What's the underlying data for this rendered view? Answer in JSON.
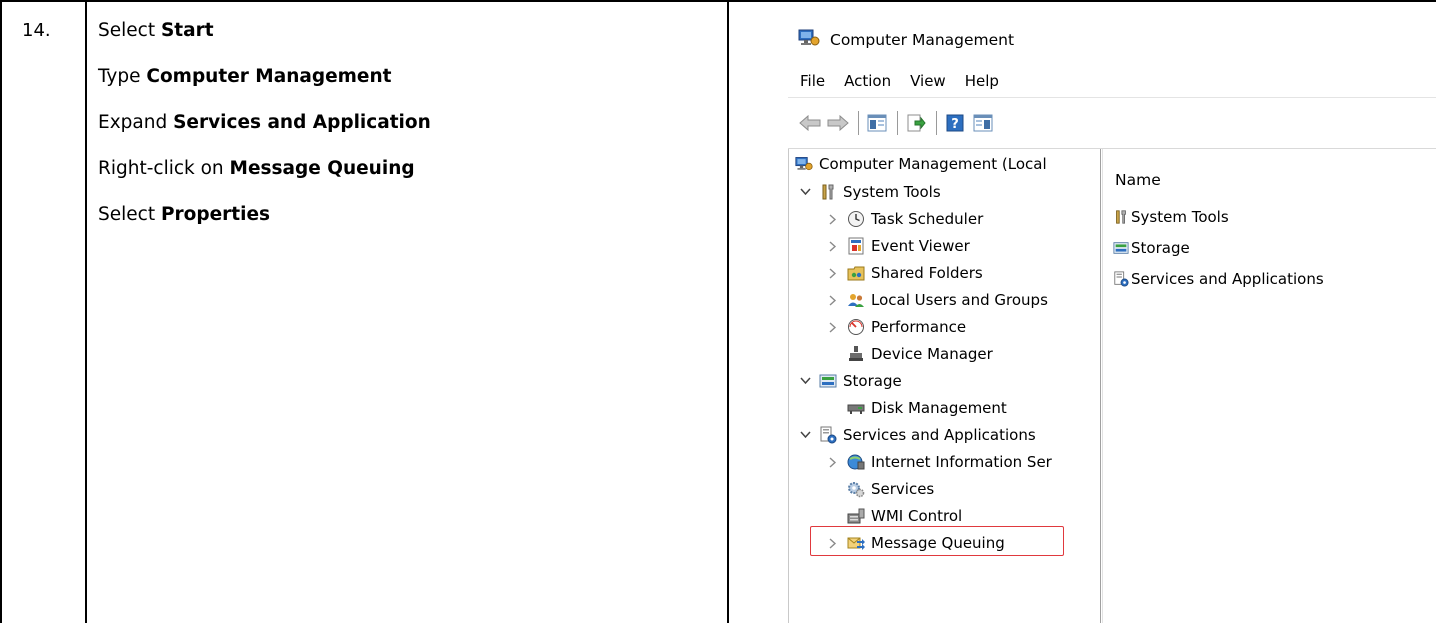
{
  "step": {
    "number": "14.",
    "lines": [
      {
        "prefix": "Select ",
        "bold": "Start"
      },
      {
        "prefix": "Type ",
        "bold": "Computer Management"
      },
      {
        "prefix": "Expand ",
        "bold": "Services and Application"
      },
      {
        "prefix": "Right-click on ",
        "bold": "Message Queuing"
      },
      {
        "prefix": "Select ",
        "bold": "Properties"
      }
    ]
  },
  "window": {
    "title": "Computer Management",
    "menu": [
      "File",
      "Action",
      "View",
      "Help"
    ]
  },
  "tree": {
    "root": "Computer Management (Local",
    "nodes": [
      {
        "label": "System Tools",
        "icon": "tools-icon",
        "expand": "expanded",
        "level": 1
      },
      {
        "label": "Task Scheduler",
        "icon": "clock-icon",
        "expand": "collapsed",
        "level": 2
      },
      {
        "label": "Event Viewer",
        "icon": "event-viewer-icon",
        "expand": "collapsed",
        "level": 2
      },
      {
        "label": "Shared Folders",
        "icon": "shared-folders-icon",
        "expand": "collapsed",
        "level": 2
      },
      {
        "label": "Local Users and Groups",
        "icon": "users-icon",
        "expand": "collapsed",
        "level": 2
      },
      {
        "label": "Performance",
        "icon": "performance-icon",
        "expand": "collapsed",
        "level": 2
      },
      {
        "label": "Device Manager",
        "icon": "device-manager-icon",
        "expand": "none",
        "level": 2
      },
      {
        "label": "Storage",
        "icon": "storage-icon",
        "expand": "expanded",
        "level": 1
      },
      {
        "label": "Disk Management",
        "icon": "disk-icon",
        "expand": "none",
        "level": 2
      },
      {
        "label": "Services and Applications",
        "icon": "services-apps-icon",
        "expand": "expanded",
        "level": 1
      },
      {
        "label": "Internet Information Ser",
        "icon": "iis-icon",
        "expand": "collapsed",
        "level": 2
      },
      {
        "label": "Services",
        "icon": "services-gear-icon",
        "expand": "none",
        "level": 2
      },
      {
        "label": "WMI Control",
        "icon": "wmi-icon",
        "expand": "none",
        "level": 2
      },
      {
        "label": "Message Queuing",
        "icon": "message-queuing-icon",
        "expand": "collapsed",
        "level": 2
      }
    ]
  },
  "list": {
    "column": "Name",
    "items": [
      {
        "label": "System Tools",
        "icon": "tools-icon"
      },
      {
        "label": "Storage",
        "icon": "storage-icon"
      },
      {
        "label": "Services and Applications",
        "icon": "services-apps-icon"
      }
    ]
  },
  "colors": {
    "highlight_border": "#e0393e",
    "icon_blue": "#2d6fc0",
    "icon_green": "#3aa141"
  }
}
